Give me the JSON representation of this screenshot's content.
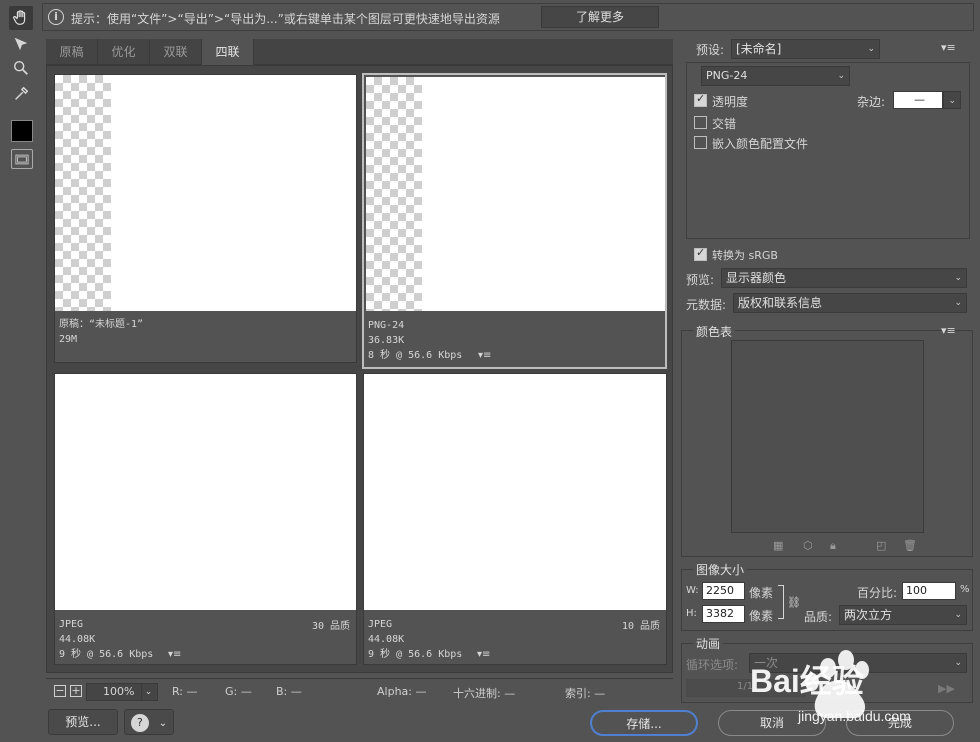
{
  "hint": {
    "text": "提示：使用“文件”>“导出”>“导出为...”或右键单击某个图层可更快速地导出资源",
    "learn_more": "了解更多"
  },
  "tabs": [
    "原稿",
    "优化",
    "双联",
    "四联"
  ],
  "active_tab": "四联",
  "panes": [
    {
      "line1": "原稿：“未标题-1”",
      "line2": "29M",
      "line3": "",
      "quality": "",
      "transparent": true
    },
    {
      "line1": "PNG-24",
      "line2": "36.83K",
      "line3": "8 秒 @ 56.6 Kbps",
      "quality": "",
      "transparent": true
    },
    {
      "line1": "JPEG",
      "line2": "44.08K",
      "line3": "9 秒 @ 56.6 Kbps",
      "quality": "30 品质",
      "transparent": false
    },
    {
      "line1": "JPEG",
      "line2": "44.08K",
      "line3": "9 秒 @ 56.6 Kbps",
      "quality": "10 品质",
      "transparent": false
    }
  ],
  "pane_menu_icon": "▾≡",
  "status": {
    "zoom": "100%",
    "r": "R: —",
    "g": "G: —",
    "b": "B: —",
    "alpha": "Alpha: —",
    "hex": "十六进制: —",
    "index": "索引: —"
  },
  "buttons": {
    "preview": "预览...",
    "save": "存储...",
    "cancel": "取消",
    "done": "完成"
  },
  "settings": {
    "preset_label": "预设:",
    "preset_value": "[未命名]",
    "format": "PNG-24",
    "transparency": "透明度",
    "transparency_checked": true,
    "matte_label": "杂边:",
    "matte_value": "—",
    "interlaced": "交错",
    "interlaced_checked": false,
    "embed_profile": "嵌入颜色配置文件",
    "embed_checked": false,
    "convert_srgb": "转换为 sRGB",
    "convert_checked": true,
    "preview_label": "预览:",
    "preview_value": "显示器颜色",
    "metadata_label": "元数据:",
    "metadata_value": "版权和联系信息"
  },
  "color_table": {
    "title": "颜色表"
  },
  "image_size": {
    "title": "图像大小",
    "w_label": "W:",
    "w_value": "2250",
    "h_label": "H:",
    "h_value": "3382",
    "unit": "像素",
    "percent_label": "百分比:",
    "percent_value": "100",
    "percent_unit": "%",
    "quality_label": "品质:",
    "quality_value": "两次立方"
  },
  "animation": {
    "title": "动画",
    "loop_label": "循环选项:",
    "loop_value": "一次",
    "frame": "1/1"
  },
  "watermark": {
    "brand": "Bai经验",
    "url": "jingyan.baidu.com"
  }
}
